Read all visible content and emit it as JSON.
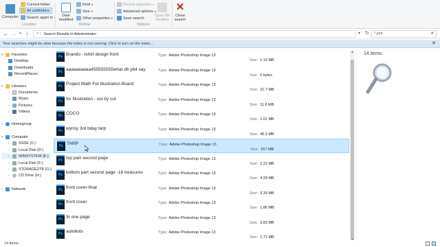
{
  "ribbon": {
    "computer_label": "Computer",
    "current_folder": "Current folder",
    "all_subfolders": "All subfolders",
    "search_again_in": "Search again in",
    "location_group": "Location",
    "date_modified": "Date modified",
    "kind": "Kind",
    "size": "Size",
    "other_properties": "Other properties",
    "refine_group": "Refine",
    "recent_searches": "Recent searches",
    "advanced_options": "Advanced options",
    "save_search": "Save search",
    "open_file_location": "Open file location",
    "options_group": "Options",
    "close_search": "Close search"
  },
  "address": {
    "path": "Search Results in Administrator",
    "search_value": "*.psd"
  },
  "infobar": {
    "message": "Your searches might be slow because the index is not running.  Click to turn on the index..."
  },
  "nav": {
    "favorites": "Favorites",
    "desktop": "Desktop",
    "downloads": "Downloads",
    "recent_places": "RecentPlaces",
    "libraries": "Libraries",
    "documents": "Documents",
    "music": "Music",
    "pictures": "Pictures",
    "videos": "Videos",
    "homegroup": "Homegroup",
    "computer": "Computer",
    "ssd": "SSDE (C:)",
    "local_d": "Local Disk (D:)",
    "winsystem": "WINSYSTEM (E:)",
    "local_f": "Local Disk (F:)",
    "storage": "STORAGE2TB (G:)",
    "cd_drive": "CD Drive (H:)",
    "network": "Network"
  },
  "files": {
    "type_key": "Type:",
    "size_key": "Size:",
    "rows": [
      {
        "name": "Brando - tshirt design front",
        "type": "Adobe Photoshop Image 13",
        "size": "1.14 MB"
      },
      {
        "name": "aaaaaaaaaa455555555what d6 y64 say",
        "type": "Adobe Photoshop Image 13",
        "size": "0 bytes"
      },
      {
        "name": "Project Math For illustration Board",
        "type": "Adobe Photoshop Image 13",
        "size": "21.7 MB"
      },
      {
        "name": "for Illustration - cut by cut",
        "type": "Adobe Photoshop Image 13",
        "size": "11.6 MB"
      },
      {
        "name": "COCO",
        "type": "Adobe Photoshop Image 13",
        "size": "1.01 MB"
      },
      {
        "name": "wynsy 3rd bday tarp",
        "type": "Adobe Photoshop Image 13",
        "size": "40.2 MB"
      },
      {
        "name": "TARP",
        "type": "Adobe Photoshop Image 13",
        "size": "157 MB"
      },
      {
        "name": "top part second page",
        "type": "Adobe Photoshop Image 13",
        "size": "2.22 MB"
      },
      {
        "name": "bottom part second page -18 treasures",
        "type": "Adobe Photoshop Image 13",
        "size": "4.29 MB"
      },
      {
        "name": "front cover-final",
        "type": "Adobe Photoshop Image 13",
        "size": "3.39 MB"
      },
      {
        "name": "front cover",
        "type": "Adobe Photoshop Image 13",
        "size": "1.86 MB"
      },
      {
        "name": "3r one page",
        "type": "Adobe Photoshop Image 13",
        "size": "3.83 MB"
      },
      {
        "name": "autobots",
        "type": "Adobe Photoshop Image 13",
        "size": "1.71 MB"
      }
    ],
    "icon_label": "Ps"
  },
  "preview": {
    "count": "14 items"
  },
  "status": {
    "count": "14 items"
  },
  "colors": {
    "accent": "#31a8ff",
    "selection": "#cce8ff",
    "infobar": "#d8e7f4"
  }
}
